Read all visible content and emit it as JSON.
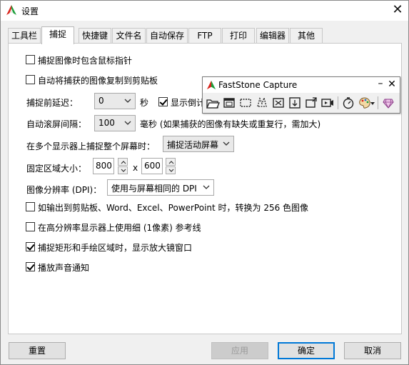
{
  "window": {
    "title": "设置"
  },
  "tabs": [
    "工具栏",
    "捕捉",
    "快捷键",
    "文件名",
    "自动保存",
    "FTP",
    "打印",
    "编辑器",
    "其他"
  ],
  "options": {
    "include_cursor": {
      "label": "捕捉图像时包含鼠标指针",
      "checked": false
    },
    "auto_copy": {
      "label": "自动将捕获的图像复制到剪贴板",
      "checked": false
    },
    "capture_delay": {
      "label": "捕捉前延迟：",
      "value": "0",
      "unit": "秒"
    },
    "show_countdown": {
      "label": "显示倒计",
      "checked": true
    },
    "scroll_interval": {
      "label": "自动滚屏间隔：",
      "value": "100",
      "unit": "毫秒 (如果捕获的图像有缺失或重复行，需加大)"
    },
    "multi_monitor": {
      "label": "在多个显示器上捕捉整个屏幕时：",
      "value": "捕捉活动屏幕"
    },
    "fixed_size": {
      "label": "固定区域大小：",
      "width": "800",
      "x": "x",
      "height": "600"
    },
    "dpi": {
      "label": "图像分辨率 (DPI)：",
      "value": "使用与屏幕相同的 DPI"
    },
    "convert_256": {
      "label": "如输出到剪贴板、Word、Excel、PowerPoint 时，转换为 256 色图像",
      "checked": false
    },
    "thin_guides": {
      "label": "在高分辨率显示器上使用细 (1像素) 参考线",
      "checked": false
    },
    "magnifier": {
      "label": "捕捉矩形和手绘区域时，显示放大镜窗口",
      "checked": true
    },
    "sound": {
      "label": "播放声音通知",
      "checked": true
    }
  },
  "buttons": {
    "reset": "重置",
    "apply": "应用",
    "ok": "确定",
    "cancel": "取消"
  },
  "floating_toolbar": {
    "title": "FastStone Capture",
    "minimize": "–",
    "close": "✕",
    "tools": [
      "open-folder-icon",
      "capture-active-window-icon",
      "capture-rectangle-icon",
      "capture-freehand-icon",
      "capture-fullscreen-icon",
      "capture-scrolling-icon",
      "capture-fixed-region-icon",
      "screen-recorder-icon",
      "timer-icon",
      "output-palette-icon",
      "settings-icon"
    ]
  },
  "colors": {
    "accent": "#0078d7",
    "logo_red": "#d9251c",
    "logo_green": "#1f9e3d"
  }
}
